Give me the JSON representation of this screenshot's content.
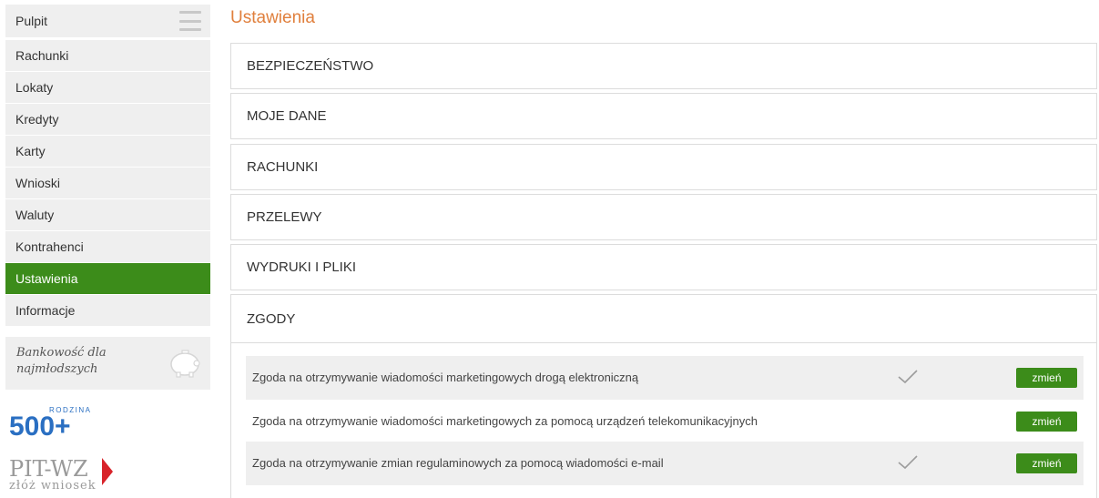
{
  "sidebar": {
    "items": [
      {
        "label": "Pulpit"
      },
      {
        "label": "Rachunki"
      },
      {
        "label": "Lokaty"
      },
      {
        "label": "Kredyty"
      },
      {
        "label": "Karty"
      },
      {
        "label": "Wnioski"
      },
      {
        "label": "Waluty"
      },
      {
        "label": "Kontrahenci"
      },
      {
        "label": "Ustawienia",
        "active": true
      },
      {
        "label": "Informacje"
      }
    ],
    "promo": {
      "line1": "Bankowość dla",
      "line2": "najmłodszych"
    },
    "logo_500": {
      "text": "500+",
      "badge": "RODZINA"
    },
    "logo_pit": {
      "text": "PIT-WZ",
      "sub": "złóż wniosek"
    }
  },
  "main": {
    "title": "Ustawienia",
    "sections": [
      "BEZPIECZEŃSTWO",
      "MOJE DANE",
      "RACHUNKI",
      "PRZELEWY",
      "WYDRUKI I PLIKI"
    ],
    "zgody": {
      "label": "ZGODY",
      "rows": [
        {
          "text": "Zgoda na otrzymywanie wiadomości marketingowych drogą elektroniczną",
          "checked": true,
          "button": "zmień"
        },
        {
          "text": "Zgoda na otrzymywanie wiadomości marketingowych za pomocą urządzeń telekomunikacyjnych",
          "checked": false,
          "button": "zmień"
        },
        {
          "text": "Zgoda na otrzymywanie zmian regulaminowych za pomocą wiadomości e-mail",
          "checked": true,
          "button": "zmień"
        }
      ]
    }
  },
  "colors": {
    "accent_green": "#3c8c1a",
    "title_orange": "#e07f3c",
    "logo_blue": "#2a6fc2",
    "logo_red": "#d8232a"
  }
}
